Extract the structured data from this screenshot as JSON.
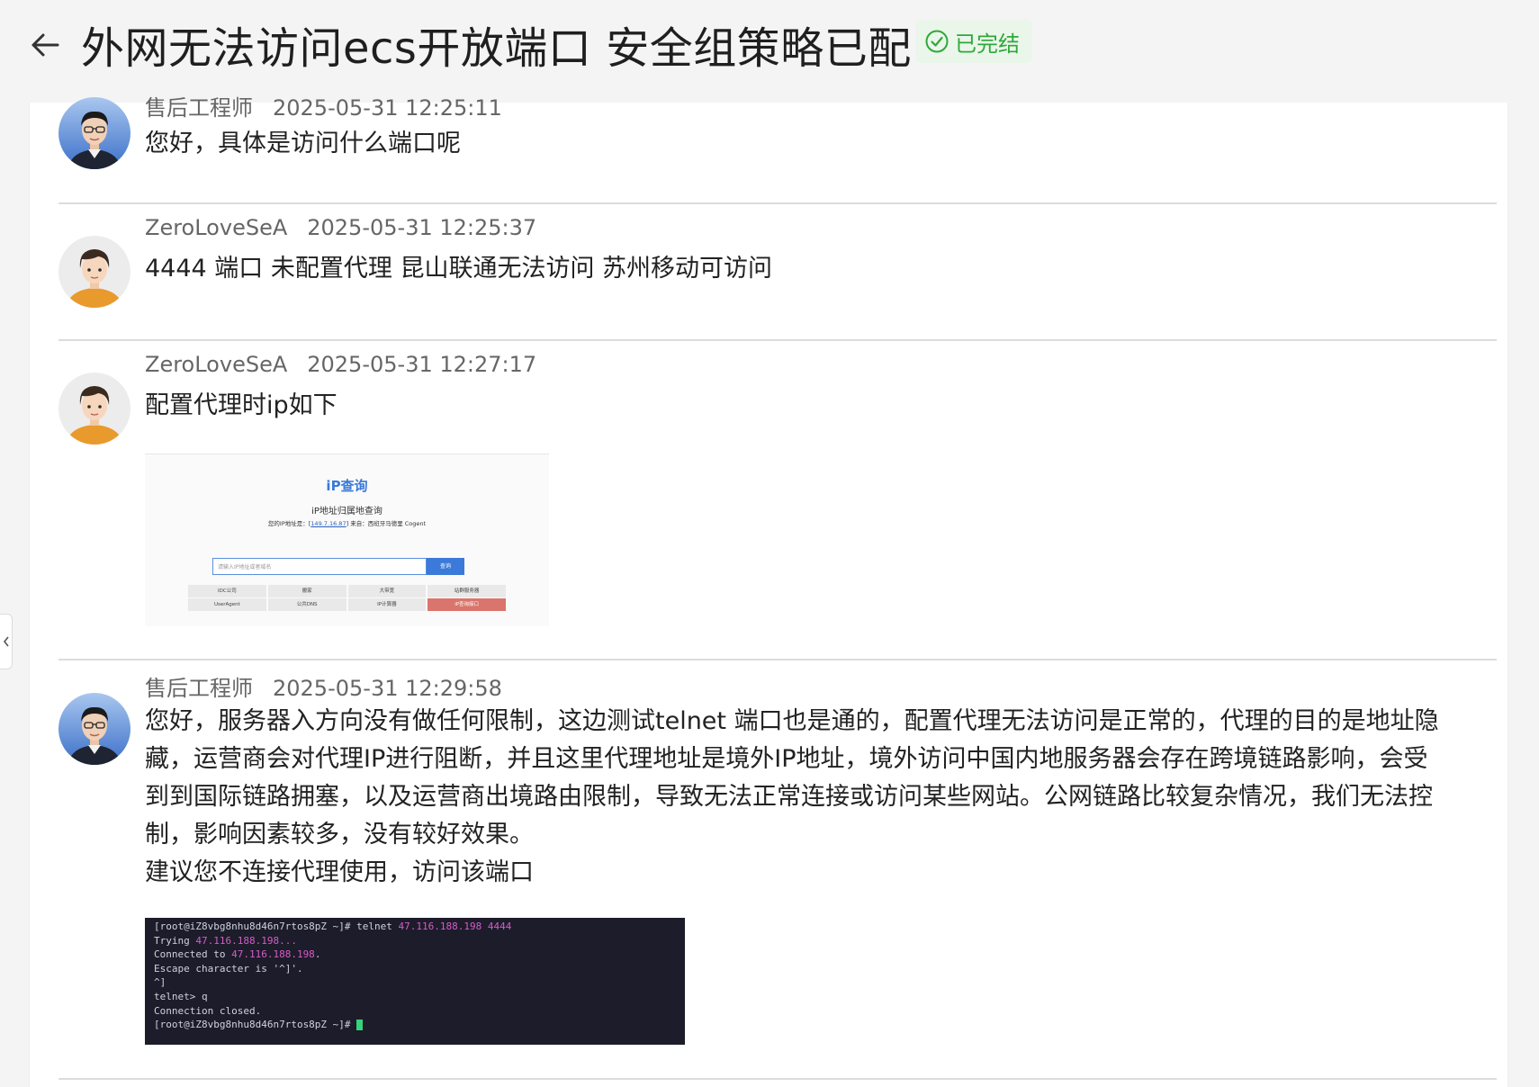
{
  "header": {
    "title": "外网无法访问ecs开放端口 安全组策略已配",
    "status": "已完结"
  },
  "colors": {
    "status_green": "#2fa83a",
    "status_bg": "#eaf6ea",
    "terminal_bg": "#1c1c2a",
    "terminal_highlight": "#d65cc7",
    "ip_accent": "#3b7ad9",
    "ip_active_tab": "#d9756c"
  },
  "messages": [
    {
      "author": "售后工程师",
      "time": "2025-05-31 12:25:11",
      "avatar": "engineer-avatar",
      "text": [
        "您好，具体是访问什么端口呢"
      ]
    },
    {
      "author": "ZeroLoveSeA",
      "time": "2025-05-31 12:25:37",
      "avatar": "user-avatar",
      "text": [
        "4444 端口 未配置代理 昆山联通无法访问 苏州移动可访问"
      ]
    },
    {
      "author": "ZeroLoveSeA",
      "time": "2025-05-31 12:27:17",
      "avatar": "user-avatar",
      "text": [
        "配置代理时ip如下"
      ],
      "attachment": {
        "heading": "iP查询",
        "subheading": "iP地址归属地查询",
        "ip_line_prefix": "您的IP地址是：[",
        "ip": "149.7.16.87",
        "ip_line_suffix": "] 来自：西班牙马德里 Cogent",
        "search_placeholder": "请输入IP地址或者域名",
        "search_button": "查询",
        "tabs_row1": [
          "IDC公司",
          "搬家",
          "大带宽",
          "站群服务器"
        ],
        "tabs_row2": [
          "UserAgent",
          "公共DNS",
          "IP计算器",
          "iP查询接口"
        ]
      }
    },
    {
      "author": "售后工程师",
      "time": "2025-05-31 12:29:58",
      "avatar": "engineer-avatar",
      "text": [
        "您好，服务器入方向没有做任何限制，这边测试telnet 端口也是通的，配置代理无法访问是正常的，代理的目的是地址隐",
        "藏，运营商会对代理IP进行阻断，并且这里代理地址是境外IP地址，境外访问中国内地服务器会存在跨境链路影响，会受",
        "到到国际链路拥塞，以及运营商出境路由限制，导致无法正常连接或访问某些网站。公网链路比较复杂情况，我们无法控",
        "制，影响因素较多，没有较好效果。",
        "建议您不连接代理使用，访问该端口"
      ],
      "terminal": {
        "line1_prompt": "[root@iZ8vbg8nhu8d46n7rtos8pZ ~]# telnet ",
        "line1_host": "47.116.188.198 4444",
        "line2_prefix": "Trying ",
        "line2_host": "47.116.188.198...",
        "line3_prefix": "Connected to ",
        "line3_host": "47.116.188.198",
        "line3_suffix": ".",
        "line4": "Escape character is '^]'.",
        "line5": "^]",
        "line6": "telnet> q",
        "line7": "Connection closed.",
        "line8": "[root@iZ8vbg8nhu8d46n7rtos8pZ ~]# "
      }
    }
  ]
}
